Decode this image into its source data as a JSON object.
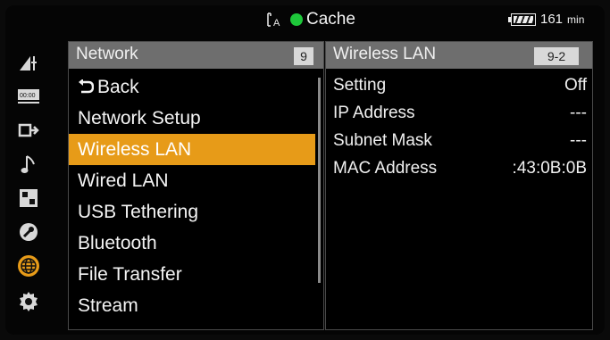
{
  "status": {
    "media_label": "Cache",
    "battery_value": "161",
    "battery_unit": "min"
  },
  "categories": [
    {
      "icon": "camera-settings-icon"
    },
    {
      "icon": "timecode-icon"
    },
    {
      "icon": "output-icon"
    },
    {
      "icon": "audio-icon"
    },
    {
      "icon": "thumbnail-icon"
    },
    {
      "icon": "maintenance-icon"
    },
    {
      "icon": "network-icon",
      "active": true
    },
    {
      "icon": "system-icon"
    }
  ],
  "menu": {
    "title": "Network",
    "page": "9",
    "items": [
      {
        "label": "Back"
      },
      {
        "label": "Network Setup"
      },
      {
        "label": "Wireless LAN",
        "selected": true
      },
      {
        "label": "Wired LAN"
      },
      {
        "label": "USB Tethering"
      },
      {
        "label": "Bluetooth"
      },
      {
        "label": "File Transfer"
      },
      {
        "label": "Stream"
      }
    ]
  },
  "detail": {
    "title": "Wireless LAN",
    "page": "9-2",
    "rows": [
      {
        "key": "Setting",
        "value": "Off"
      },
      {
        "key": "IP Address",
        "value": "---"
      },
      {
        "key": "Subnet Mask",
        "value": "---"
      },
      {
        "key": "MAC Address",
        "value": ":43:0B:0B"
      }
    ]
  },
  "colors": {
    "accent": "#e79b18",
    "header": "#6e6e6e",
    "media_ok": "#1ec83a"
  }
}
